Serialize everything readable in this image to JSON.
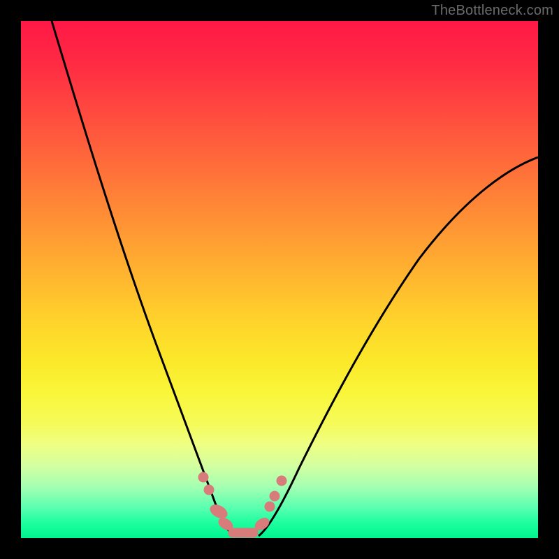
{
  "watermark": "TheBottleneck.com",
  "chart_data": {
    "type": "line",
    "title": "",
    "xlabel": "",
    "ylabel": "",
    "xlim": [
      0,
      100
    ],
    "ylim": [
      0,
      100
    ],
    "series": [
      {
        "name": "left-curve",
        "x": [
          6,
          10,
          15,
          20,
          25,
          28,
          31,
          33,
          35,
          36.5,
          38,
          39.5,
          41
        ],
        "values": [
          100,
          80,
          58,
          40,
          25,
          18,
          12,
          8.5,
          6,
          4.5,
          3,
          1.5,
          0.5
        ]
      },
      {
        "name": "right-curve",
        "x": [
          46,
          48,
          51,
          55,
          60,
          66,
          73,
          81,
          90,
          100
        ],
        "values": [
          0.5,
          2.5,
          6,
          12,
          20,
          30,
          42,
          54,
          65,
          74
        ]
      }
    ],
    "markers": {
      "name": "dotted-segment",
      "color": "#d77c7b",
      "points_xy": [
        [
          35.2,
          11.8
        ],
        [
          36.3,
          9.3
        ],
        [
          37.8,
          5.6
        ],
        [
          38.8,
          3.4
        ],
        [
          39.8,
          1.6
        ],
        [
          41.5,
          0.9
        ],
        [
          43.3,
          0.9
        ],
        [
          45.2,
          1.5
        ],
        [
          46.4,
          3.2
        ],
        [
          47.9,
          6.6
        ],
        [
          48.8,
          8.6
        ],
        [
          50.2,
          11.4
        ]
      ]
    },
    "background_gradient": {
      "direction": "vertical",
      "stops": [
        {
          "pos": 0.0,
          "color": "#ff1846"
        },
        {
          "pos": 0.28,
          "color": "#ff6d3a"
        },
        {
          "pos": 0.58,
          "color": "#ffd32b"
        },
        {
          "pos": 0.78,
          "color": "#f6fb5a"
        },
        {
          "pos": 0.9,
          "color": "#a5ffb2"
        },
        {
          "pos": 1.0,
          "color": "#00f58f"
        }
      ]
    }
  }
}
